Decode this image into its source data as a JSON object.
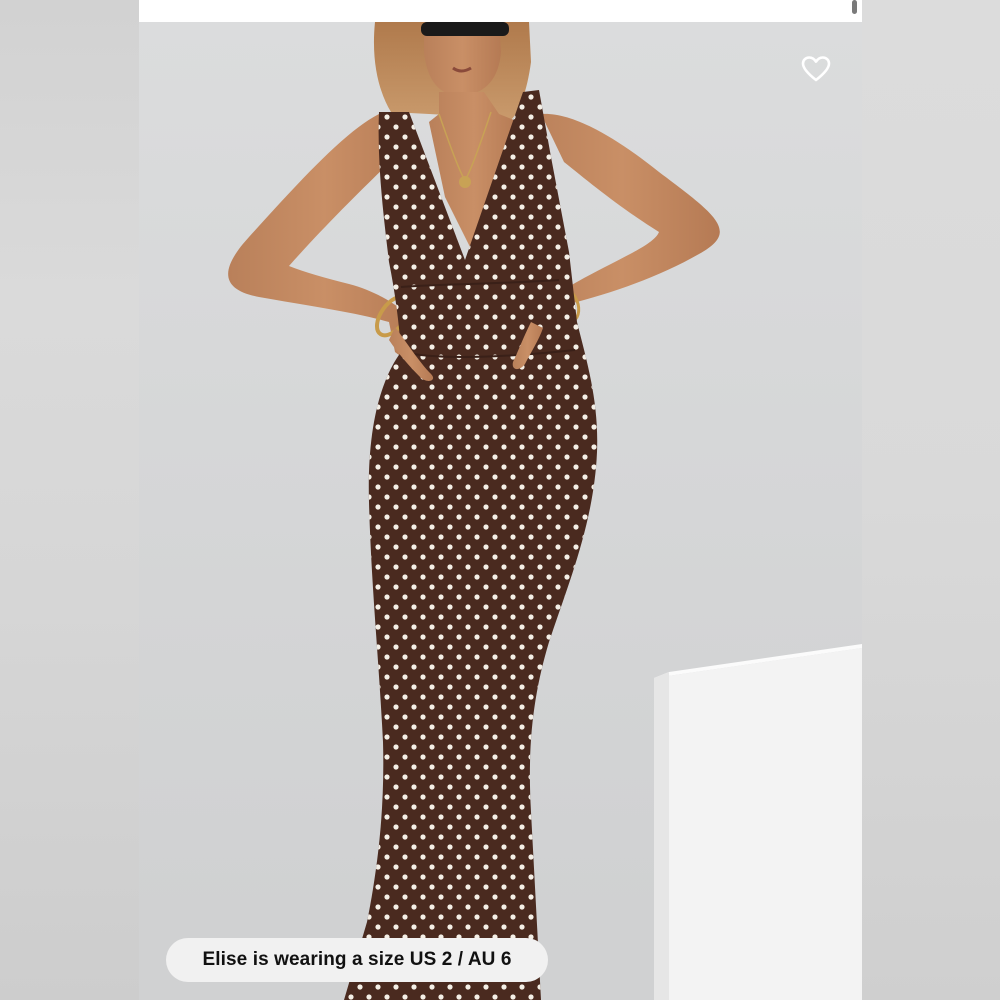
{
  "product_image": {
    "alt_subject": "model wearing brown polka dot maxi dress",
    "dress_color": "#4a2a1f",
    "dot_color": "#f4efe6",
    "backdrop_color": "#d5d6d7"
  },
  "favorite": {
    "icon": "heart-outline-icon",
    "color": "#ffffff"
  },
  "size_note": {
    "text": "Elise is wearing a size US 2 / AU 6"
  }
}
